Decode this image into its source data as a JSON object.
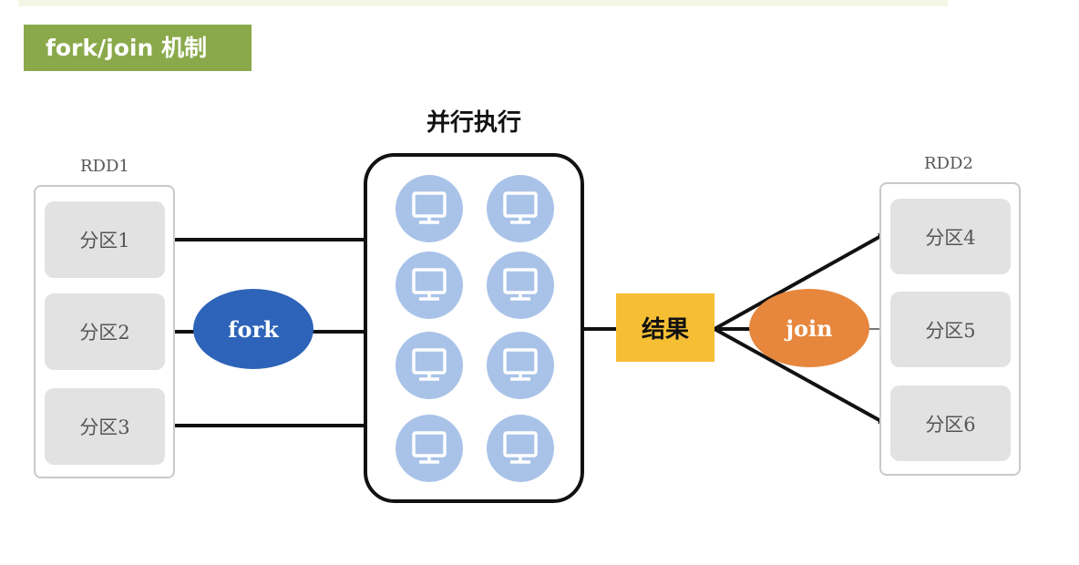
{
  "title": "fork/join 机制",
  "parallel": {
    "heading": "并行执行",
    "node_count": 8,
    "node_icon": "monitor-icon"
  },
  "rdd1": {
    "label": "RDD1",
    "partitions": [
      "分区1",
      "分区2",
      "分区3"
    ]
  },
  "rdd2": {
    "label": "RDD2",
    "partitions": [
      "分区4",
      "分区5",
      "分区6"
    ]
  },
  "fork_label": "fork",
  "join_label": "join",
  "result_label": "结果",
  "colors": {
    "title_bg": "#8aa94a",
    "fork": "#2d63b8",
    "join": "#e6873d",
    "result": "#f5be35",
    "node": "#a9c3e8",
    "partition": "#e2e2e2"
  }
}
